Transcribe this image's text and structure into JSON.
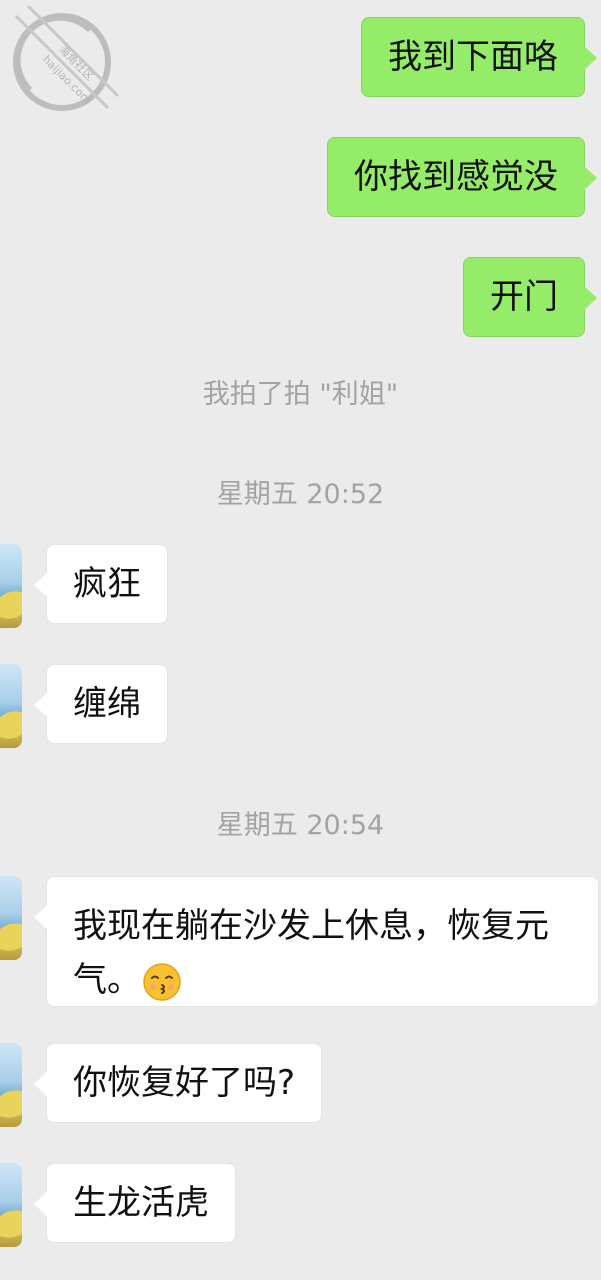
{
  "watermark": {
    "line1": "海角社区",
    "line2": "haijiao.com"
  },
  "messages": [
    {
      "id": "m1",
      "side": "out",
      "text": "我到下面咯"
    },
    {
      "id": "m2",
      "side": "out",
      "text": "你找到感觉没"
    },
    {
      "id": "m3",
      "side": "out",
      "text": "开门"
    },
    {
      "id": "s1",
      "type": "system",
      "text": "我拍了拍 \"利姐\""
    },
    {
      "id": "t1",
      "type": "time",
      "text": "星期五 20:52"
    },
    {
      "id": "m4",
      "side": "in",
      "text": "疯狂"
    },
    {
      "id": "m5",
      "side": "in",
      "text": "缠绵"
    },
    {
      "id": "t2",
      "type": "time",
      "text": "星期五 20:54"
    },
    {
      "id": "m6",
      "side": "in",
      "text_line1": "我现在躺在沙发上休息，恢复元",
      "text_line2": "气。",
      "emoji": "kissing-face-emoji"
    },
    {
      "id": "m7",
      "side": "in",
      "text": "你恢复好了吗?"
    },
    {
      "id": "m8",
      "side": "in",
      "text": "生龙活虎"
    }
  ],
  "colors": {
    "background": "#ebebeb",
    "outgoing_bubble": "#95ec69",
    "incoming_bubble": "#ffffff",
    "system_text": "#a3a3a3"
  }
}
